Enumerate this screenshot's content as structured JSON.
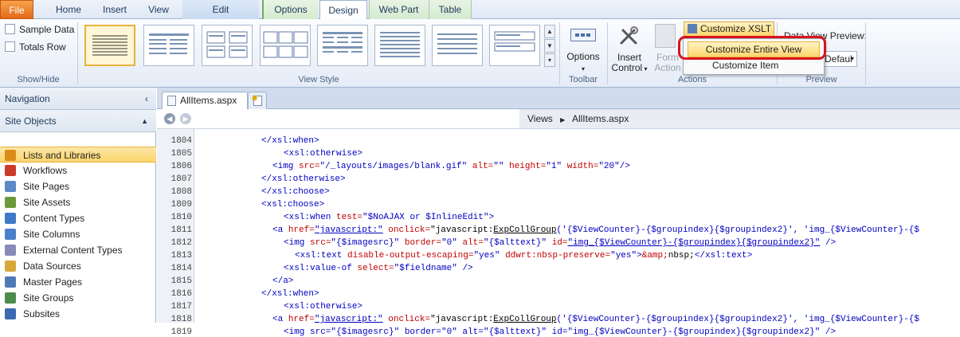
{
  "tabs": {
    "file": "File",
    "home": "Home",
    "insert": "Insert",
    "view": "View",
    "edit": "Edit",
    "options": "Options",
    "design": "Design",
    "webpart": "Web Part",
    "table": "Table"
  },
  "showhide": {
    "sample_data": "Sample Data",
    "totals_row": "Totals Row",
    "group_label": "Show/Hide"
  },
  "viewstyle": {
    "group_label": "View Style"
  },
  "toolbar": {
    "options_label": "Options",
    "group_label": "Toolbar"
  },
  "actions": {
    "insert_control": "Insert",
    "insert_control2": "Control",
    "form_action": "Form",
    "form_action2": "Action",
    "group_label": "Actions",
    "customize_xslt": "Customize XSLT"
  },
  "preview": {
    "label": "Data View Preview:",
    "value": "Defaul",
    "group_label": "Preview"
  },
  "menu": {
    "entire_view": "Customize Entire View",
    "item": "Customize Item"
  },
  "nav": {
    "header": "Navigation",
    "site_objects": "Site Objects",
    "items": [
      {
        "label": "Lists and Libraries",
        "icon": "list-icon",
        "color": "#d98c1a"
      },
      {
        "label": "Workflows",
        "icon": "workflow-icon",
        "color": "#cc3a2a"
      },
      {
        "label": "Site Pages",
        "icon": "page-icon",
        "color": "#5a8ac6"
      },
      {
        "label": "Site Assets",
        "icon": "assets-icon",
        "color": "#6a9a3a"
      },
      {
        "label": "Content Types",
        "icon": "content-type-icon",
        "color": "#3f78c4"
      },
      {
        "label": "Site Columns",
        "icon": "column-icon",
        "color": "#4a7fc9"
      },
      {
        "label": "External Content Types",
        "icon": "external-content-icon",
        "color": "#8a8ab8"
      },
      {
        "label": "Data Sources",
        "icon": "database-icon",
        "color": "#d7a83a"
      },
      {
        "label": "Master Pages",
        "icon": "master-page-icon",
        "color": "#5079b8"
      },
      {
        "label": "Site Groups",
        "icon": "group-icon",
        "color": "#4c8c4c"
      },
      {
        "label": "Subsites",
        "icon": "subsite-icon",
        "color": "#3a6bb0"
      }
    ]
  },
  "editor": {
    "tab": "AllItems.aspx",
    "crumb1": "Views",
    "crumb2": "AllItems.aspx"
  },
  "code": {
    "line_numbers": [
      "1804",
      "1805",
      "1806",
      "1807",
      "1808",
      "1809",
      "1810",
      "1811",
      "1812",
      "1813",
      "1814",
      "1815",
      "1816",
      "1817",
      "1818",
      "1819"
    ],
    "l1804": "</xsl:when>",
    "l1805": "<xsl:otherwise>",
    "l1806_a": "<img ",
    "l1806_b": "src=",
    "l1806_c": "\"/_layouts/images/blank.gif\"",
    "l1806_d": " alt=",
    "l1806_e": "\"\"",
    "l1806_f": " height=",
    "l1806_g": "\"1\"",
    "l1806_h": " width=",
    "l1806_i": "\"20\"",
    "l1806_j": "/>",
    "l1807": "</xsl:otherwise>",
    "l1808": "</xsl:choose>",
    "l1809": "<xsl:choose>",
    "l1810_a": "<xsl:when ",
    "l1810_b": "test=",
    "l1810_c": "\"$NoAJAX or $InlineEdit\"",
    "l1810_d": ">",
    "l1811_a": "<a ",
    "l1811_b": "href=",
    "l1811_c": "\"javascript:\"",
    "l1811_d": " onclick=",
    "l1811_e": "\"javascript:",
    "l1811_f": "ExpCollGroup",
    "l1811_g": "('{$ViewCounter}-{$groupindex}{$groupindex2}', 'img_{$ViewCounter}-{$",
    "l1812_a": "<img ",
    "l1812_b": "src=",
    "l1812_c": "\"{$imagesrc}\"",
    "l1812_d": " border=",
    "l1812_e": "\"0\"",
    "l1812_f": " alt=",
    "l1812_g": "\"{$alttext}\"",
    "l1812_h": " id=",
    "l1812_i": "\"img_{$ViewCounter}-{$groupindex}{$groupindex2}\"",
    "l1812_j": " />",
    "l1813_a": "<xsl:text ",
    "l1813_b": "disable-output-escaping=",
    "l1813_c": "\"yes\"",
    "l1813_d": " ddwrt:nbsp-preserve=",
    "l1813_e": "\"yes\"",
    "l1813_f": ">",
    "l1813_g": "&amp;",
    "l1813_h": "nbsp;",
    "l1813_i": "</xsl:text>",
    "l1814_a": "<xsl:value-of ",
    "l1814_b": "select=",
    "l1814_c": "\"$fieldname\"",
    "l1814_d": " />",
    "l1815": "</a>",
    "l1816": "</xsl:when>",
    "l1817": "<xsl:otherwise>",
    "l1818_a": "<a ",
    "l1818_b": "href=",
    "l1818_c": "\"javascript:\"",
    "l1818_d": " onclick=",
    "l1818_e": "\"javascript:",
    "l1818_f": "ExpCollGroup",
    "l1818_g": "('{$ViewCounter}-{$groupindex}{$groupindex2}', 'img_{$ViewCounter}-{$",
    "l1819": "<img src=\"{$imagesrc}\" border=\"0\" alt=\"{$alttext}\" id=\"img_{$ViewCounter}-{$groupindex}{$groupindex2}\" />"
  },
  "colors": {
    "highlight_ring": "#d9141c",
    "nav_active": "#fbd56b",
    "tag": "#0000c0",
    "attr": "#c00000"
  }
}
